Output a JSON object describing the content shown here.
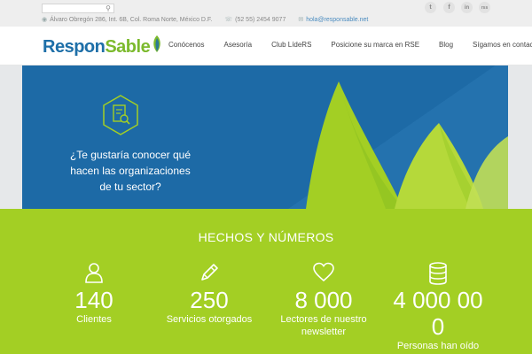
{
  "topbar": {
    "address": "Álvaro Obregón 286, Int. 6B, Col. Roma Norte, México D.F.",
    "phone": "(52 55) 2454 9077",
    "email": "hola@responsable.net",
    "social": [
      {
        "label": "t",
        "icon": "twitter-icon"
      },
      {
        "label": "f",
        "icon": "facebook-icon"
      },
      {
        "label": "in",
        "icon": "linkedin-icon"
      },
      {
        "label": "rss",
        "icon": "rss-icon"
      }
    ]
  },
  "brand": {
    "name_part1": "Respon",
    "name_part2": "Sable",
    "color_blue": "#1e6fa8",
    "color_green": "#7cba2d"
  },
  "nav": {
    "items": [
      "Conócenos",
      "Asesoría",
      "Club LídeRS",
      "Posicione su marca en RSE",
      "Blog",
      "Sígamos en contacto"
    ]
  },
  "hero": {
    "line1": "¿Te gustaría conocer qué",
    "line2": "hacen las organizaciones",
    "line3": "de tu sector?",
    "bg_color": "#1d6aa6",
    "leaf_color": "#a3cf24"
  },
  "stats": {
    "title": "HECHOS Y NÚMEROS",
    "bg_color": "#a3cf24",
    "items": [
      {
        "value": "140",
        "label1": "Clientes",
        "label2": "",
        "icon": "user-icon"
      },
      {
        "value": "250",
        "label1": "Servicios otorgados",
        "label2": "",
        "icon": "pencil-icon"
      },
      {
        "value": "8 000",
        "label1": "Lectores de nuestro",
        "label2": "newsletter",
        "icon": "heart-icon"
      },
      {
        "value": "4 000 00",
        "value2": "0",
        "label1": "Personas han oído",
        "label2": "",
        "icon": "database-icon"
      }
    ]
  }
}
